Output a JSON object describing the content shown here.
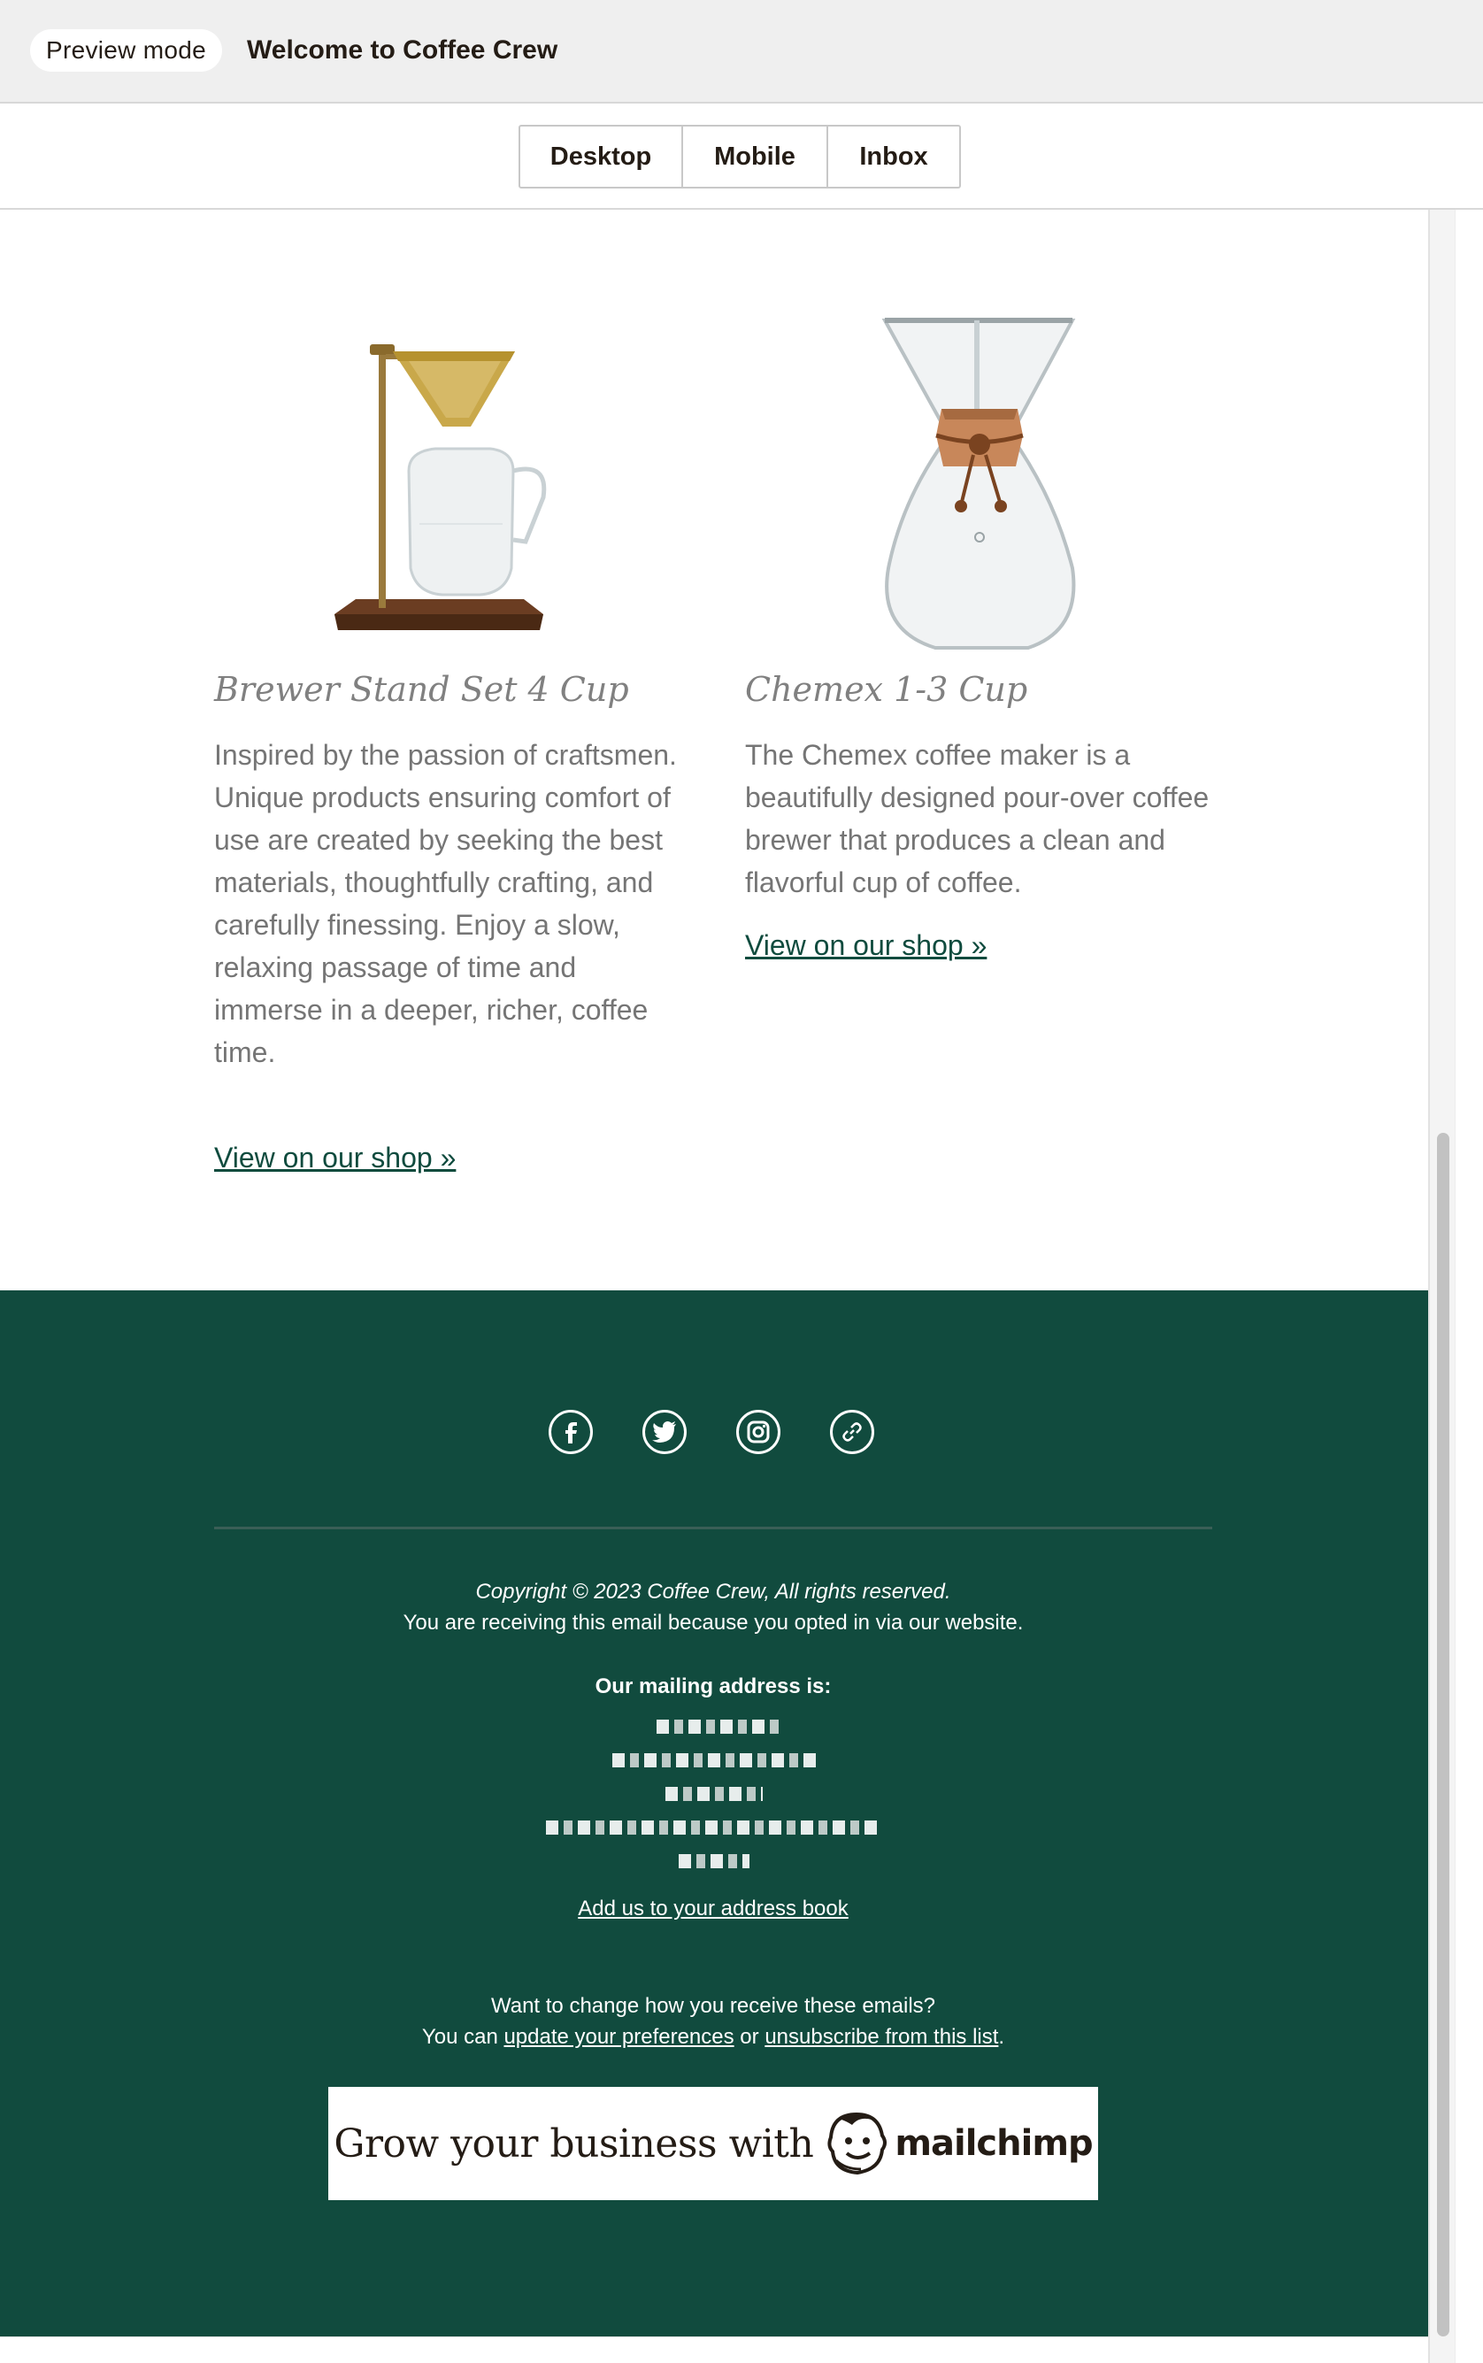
{
  "header": {
    "mode_badge": "Preview mode",
    "title": "Welcome to Coffee Crew"
  },
  "toolbar": {
    "views": [
      "Desktop",
      "Mobile",
      "Inbox"
    ]
  },
  "products": [
    {
      "name": "Brewer Stand Set 4 Cup",
      "description": "Inspired by the passion of craftsmen. Unique products ensuring comfort of use are created by seeking the best materials, thoughtfully crafting, and carefully finessing. Enjoy a slow, relaxing passage of time and immerse in a deeper, richer, coffee time.",
      "link": "View on our shop »"
    },
    {
      "name": "Chemex 1-3 Cup",
      "description": "The Chemex coffee maker is a beautifully designed pour-over coffee brewer that produces a clean and flavorful cup of coffee.",
      "link": "View on our shop »"
    }
  ],
  "footer": {
    "social_icons": [
      "facebook-icon",
      "twitter-icon",
      "instagram-icon",
      "link-icon"
    ],
    "copyright": "Copyright © 2023 Coffee Crew, All rights reserved.",
    "receiving": "You are receiving this email because you opted in via our website.",
    "mailing_label": "Our mailing address is:",
    "address_book": "Add us to your address book",
    "change_prompt": "Want to change how you receive these emails?",
    "prefs_prefix": "You can ",
    "update_prefs": "update your preferences",
    "or_text": " or ",
    "unsubscribe": "unsubscribe from this list",
    "period": ".",
    "banner_text": "Grow your business with",
    "banner_brand": "mailchimp"
  },
  "colors": {
    "footer_bg": "#114b3e",
    "link": "#0f4b3e",
    "product_name": "#808080",
    "body_text": "#757575"
  }
}
